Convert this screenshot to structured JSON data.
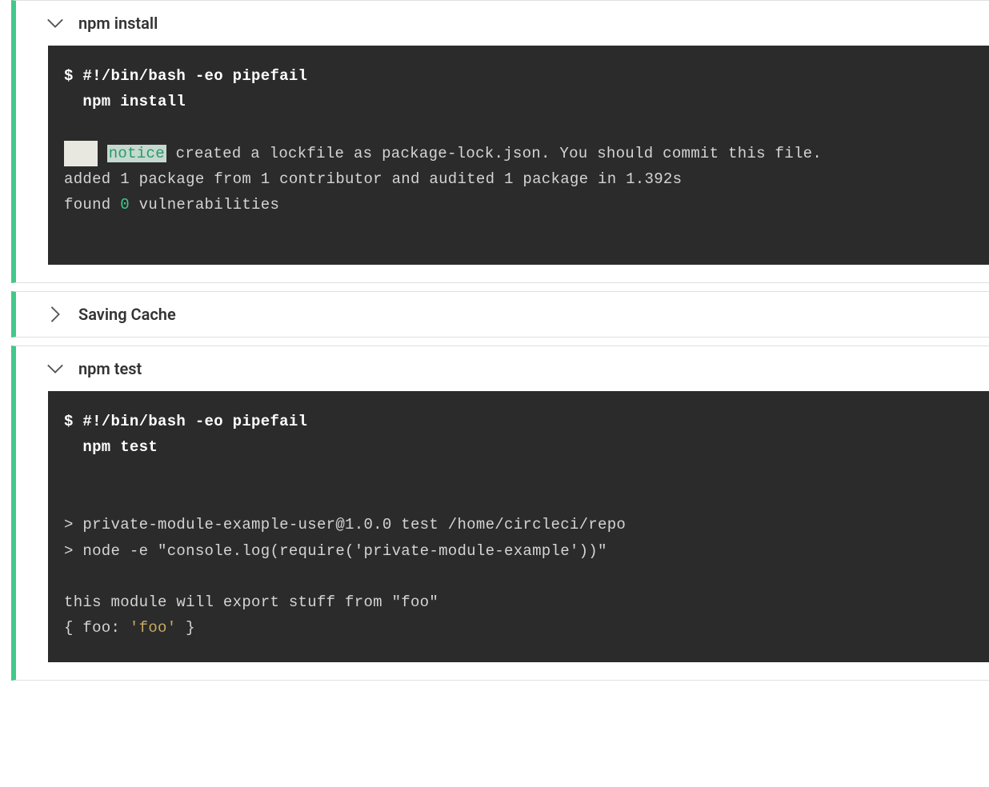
{
  "steps": [
    {
      "title": "npm install",
      "expanded": true,
      "terminal": {
        "prompt": "$",
        "shebang": "#!/bin/bash -eo pipefail",
        "command": "  npm install",
        "blank0": " ",
        "notice_pre": "    ",
        "notice_label": "notice",
        "notice_rest": " created a lockfile as package-lock.json. You should commit this file.",
        "line_added": "added 1 package from 1 contributor and audited 1 package in 1.392s",
        "line_found_a": "found ",
        "line_found_zero": "0",
        "line_found_b": " vulnerabilities",
        "blank1": " "
      }
    },
    {
      "title": "Saving Cache",
      "expanded": false
    },
    {
      "title": "npm test",
      "expanded": true,
      "terminal": {
        "prompt": "$",
        "shebang": "#!/bin/bash -eo pipefail",
        "command": "  npm test",
        "blank0": " ",
        "blank1": " ",
        "line_pkg": "> private-module-example-user@1.0.0 test /home/circleci/repo",
        "line_node": "> node -e \"console.log(require('private-module-example'))\"",
        "blank2": " ",
        "line_export": "this module will export stuff from \"foo\"",
        "line_obj_a": "{ foo: ",
        "line_obj_val": "'foo'",
        "line_obj_b": " }"
      }
    }
  ]
}
